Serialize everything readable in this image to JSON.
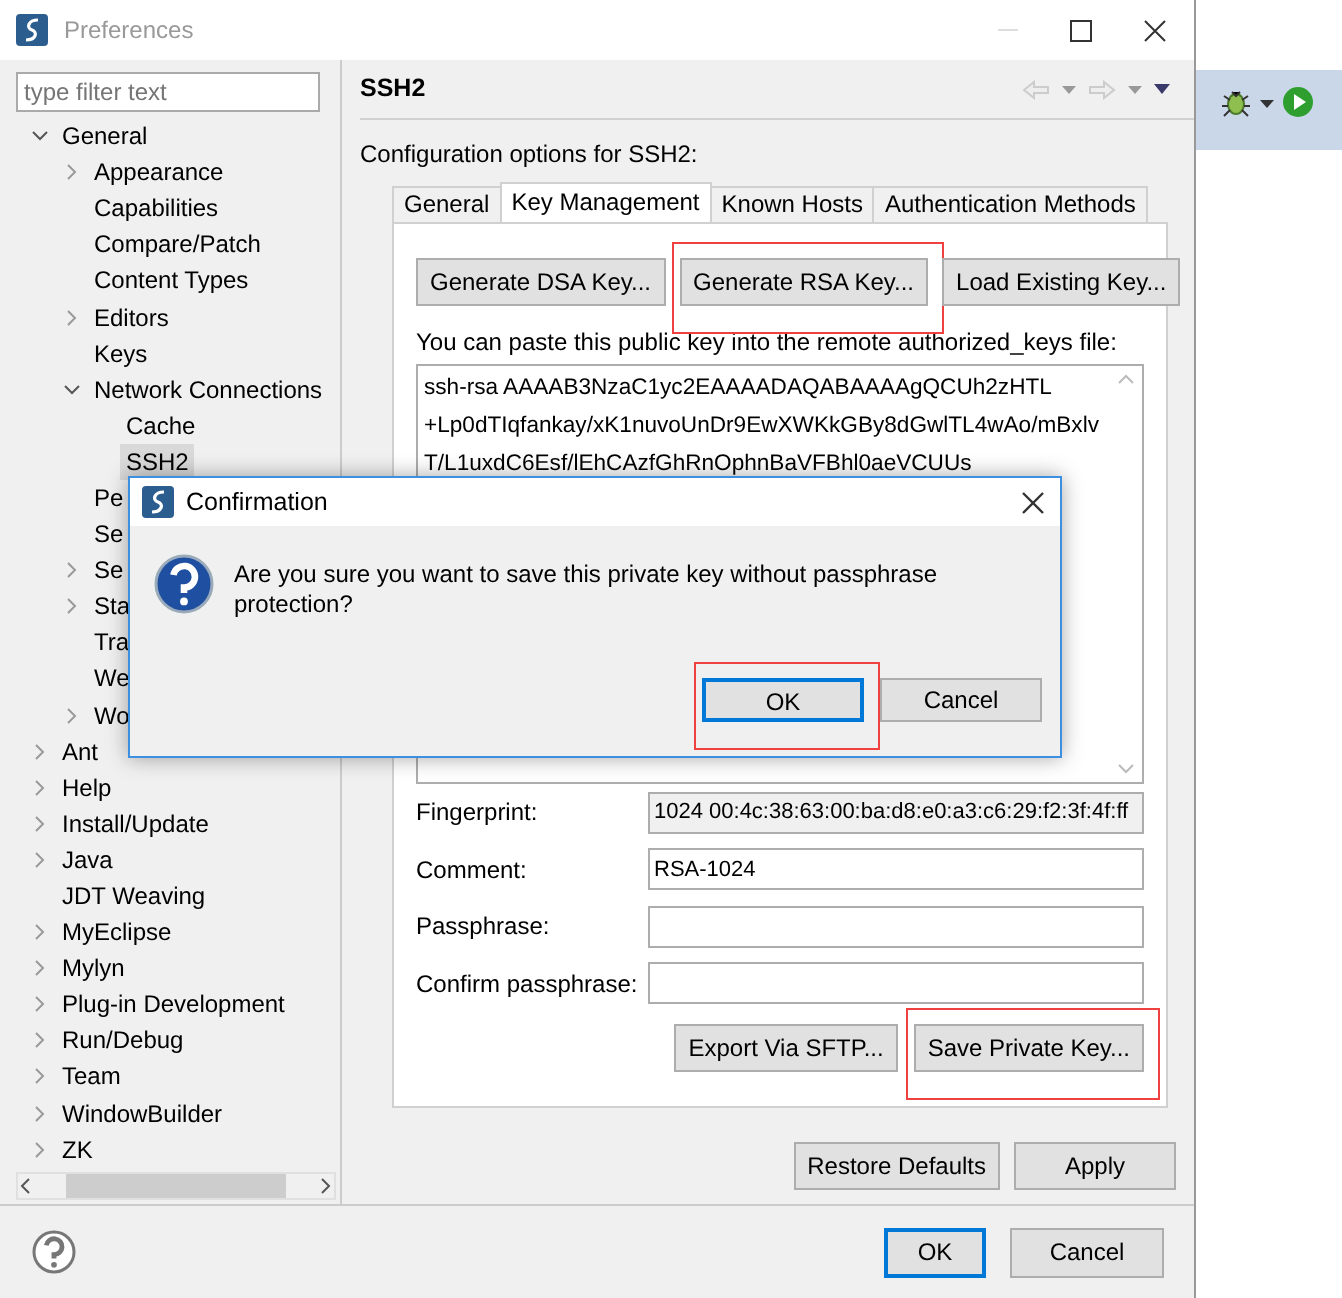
{
  "window": {
    "title": "Preferences"
  },
  "filter": {
    "placeholder": "type filter text"
  },
  "tree": [
    {
      "label": "General",
      "expanded": true,
      "selected": false,
      "children": [
        {
          "label": "Appearance",
          "expanded": false,
          "selected": false
        },
        {
          "label": "Capabilities",
          "selected": false
        },
        {
          "label": "Compare/Patch",
          "selected": false
        },
        {
          "label": "Content Types",
          "selected": false
        },
        {
          "label": "Editors",
          "expanded": false,
          "selected": false
        },
        {
          "label": "Keys",
          "selected": false
        },
        {
          "label": "Network Connections",
          "expanded": true,
          "selected": false,
          "children": [
            {
              "label": "Cache",
              "selected": false
            },
            {
              "label": "SSH2",
              "selected": true
            }
          ]
        },
        {
          "label": "Pe",
          "selected": false
        },
        {
          "label": "Se",
          "selected": false
        },
        {
          "label": "Se",
          "expanded": false,
          "selected": false
        },
        {
          "label": "Sta",
          "expanded": false,
          "selected": false
        },
        {
          "label": "Tra",
          "selected": false
        },
        {
          "label": "We",
          "selected": false
        },
        {
          "label": "Wo",
          "expanded": false,
          "selected": false
        }
      ]
    },
    {
      "label": "Ant",
      "expanded": false,
      "selected": false
    },
    {
      "label": "Help",
      "expanded": false,
      "selected": false
    },
    {
      "label": "Install/Update",
      "expanded": false,
      "selected": false
    },
    {
      "label": "Java",
      "expanded": false,
      "selected": false
    },
    {
      "label": "JDT Weaving",
      "selected": false
    },
    {
      "label": "MyEclipse",
      "expanded": false,
      "selected": false
    },
    {
      "label": "Mylyn",
      "expanded": false,
      "selected": false
    },
    {
      "label": "Plug-in Development",
      "expanded": false,
      "selected": false
    },
    {
      "label": "Run/Debug",
      "expanded": false,
      "selected": false
    },
    {
      "label": "Team",
      "expanded": false,
      "selected": false
    },
    {
      "label": "WindowBuilder",
      "expanded": false,
      "selected": false
    },
    {
      "label": "ZK",
      "expanded": false,
      "selected": false
    }
  ],
  "page": {
    "title": "SSH2",
    "description": "Configuration options for SSH2:"
  },
  "tabs": [
    {
      "label": "General",
      "selected": false
    },
    {
      "label": "Key Management",
      "selected": true
    },
    {
      "label": "Known Hosts",
      "selected": false
    },
    {
      "label": "Authentication Methods",
      "selected": false
    }
  ],
  "key_buttons": [
    {
      "label": "Generate DSA Key...",
      "highlighted": false
    },
    {
      "label": "Generate RSA Key...",
      "highlighted": true
    },
    {
      "label": "Load Existing Key...",
      "highlighted": false
    }
  ],
  "public_key_label": "You can paste this public key into the remote authorized_keys file:",
  "public_key": [
    "ssh-rsa AAAAB3NzaC1yc2EAAAADAQABAAAAgQCUh2zHTL",
    "+Lp0dTIqfankay/xK1nuvoUnDr9EwXWKkGBy8dGwlTL4wAo/mBxlv",
    "T/L1uxdC6Esf/lEhCAzfGhRnOphnBaVFBhl0aeVCUUs"
  ],
  "fields": [
    {
      "label": "Fingerprint:",
      "value": "1024 00:4c:38:63:00:ba:d8:e0:a3:c6:29:f2:3f:4f:ff",
      "disabled": true
    },
    {
      "label": "Comment:",
      "value": "RSA-1024",
      "disabled": false
    },
    {
      "label": "Passphrase:",
      "disabled": false
    },
    {
      "label": "Confirm passphrase:",
      "disabled": false
    }
  ],
  "key_actions": [
    {
      "label": "Export Via SFTP...",
      "highlighted": false
    },
    {
      "label": "Save Private Key...",
      "highlighted": true
    }
  ],
  "page_buttons": [
    "Restore Defaults",
    "Apply"
  ],
  "dialog_buttons": [
    {
      "label": "OK",
      "default": true
    },
    {
      "label": "Cancel",
      "default": false
    }
  ],
  "confirmation": {
    "title": "Confirmation",
    "message": "Are you sure you want to save this private key without passphrase protection?",
    "buttons": [
      {
        "label": "OK",
        "default": true,
        "highlighted": true
      },
      {
        "label": "Cancel",
        "default": false,
        "highlighted": false
      }
    ]
  }
}
